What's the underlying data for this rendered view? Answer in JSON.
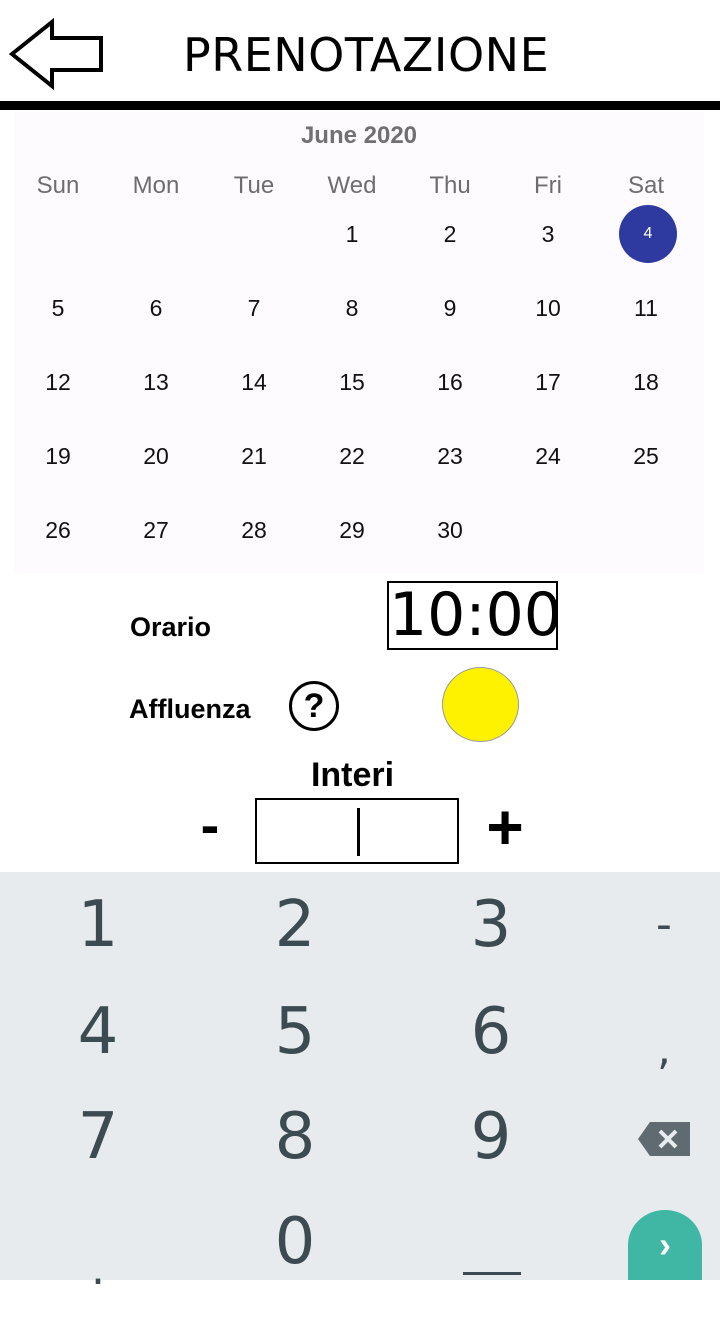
{
  "header": {
    "title": "PRENOTAZIONE",
    "back_icon": "arrow-left-icon"
  },
  "calendar": {
    "month": "June 2020",
    "weekdays": [
      "Sun",
      "Mon",
      "Tue",
      "Wed",
      "Thu",
      "Fri",
      "Sat"
    ],
    "weeks": [
      [
        "",
        "",
        "",
        "1",
        "2",
        "3",
        "4"
      ],
      [
        "5",
        "6",
        "7",
        "8",
        "9",
        "10",
        "11"
      ],
      [
        "12",
        "13",
        "14",
        "15",
        "16",
        "17",
        "18"
      ],
      [
        "19",
        "20",
        "21",
        "22",
        "23",
        "24",
        "25"
      ],
      [
        "26",
        "27",
        "28",
        "29",
        "30",
        "",
        ""
      ]
    ],
    "selected_day": "4",
    "selected_color": "#2f3aa1"
  },
  "form": {
    "orario_label": "Orario",
    "time_value": "10:00",
    "affluenza_label": "Affluenza",
    "help_symbol": "?",
    "crowd_color": "#fff200",
    "interi_title": "Interi",
    "minus_label": "-",
    "plus_label": "+",
    "quantity_value": ""
  },
  "keyboard": {
    "keys": [
      [
        "1",
        "2",
        "3",
        "-"
      ],
      [
        "4",
        "5",
        "6",
        ","
      ],
      [
        "7",
        "8",
        "9",
        "backspace"
      ],
      [
        ".",
        "0",
        "space",
        "enter"
      ]
    ],
    "enter_color": "#3fb7a4"
  }
}
